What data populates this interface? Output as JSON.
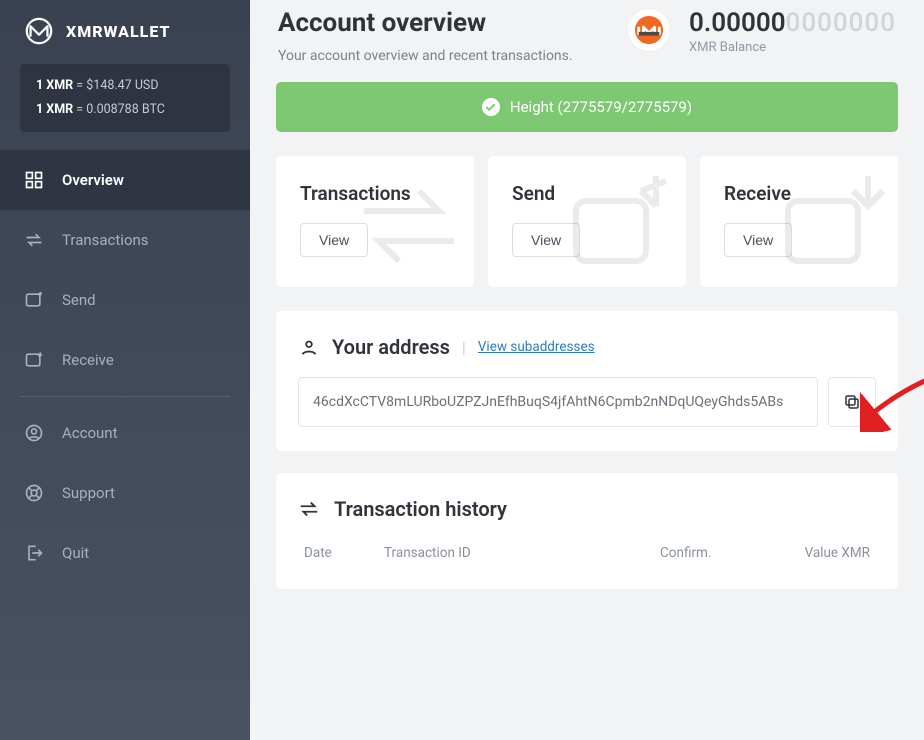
{
  "brand": "XMRWALLET",
  "rates": {
    "usd_label": "1 XMR",
    "usd_eq": "=",
    "usd_value": "$148.47",
    "usd_suffix": "USD",
    "btc_label": "1 XMR",
    "btc_eq": "=",
    "btc_value": "0.008788",
    "btc_suffix": "BTC"
  },
  "nav": {
    "overview": "Overview",
    "transactions": "Transactions",
    "send": "Send",
    "receive": "Receive",
    "account": "Account",
    "support": "Support",
    "quit": "Quit"
  },
  "header": {
    "title": "Account overview",
    "subtitle": "Your account overview and recent transactions.",
    "balance_main": "0.00000",
    "balance_faint": "0000000",
    "balance_label": "XMR Balance"
  },
  "height_banner": "Height (2775579/2775579)",
  "cards": {
    "transactions": {
      "title": "Transactions",
      "view": "View"
    },
    "send": {
      "title": "Send",
      "view": "View"
    },
    "receive": {
      "title": "Receive",
      "view": "View"
    }
  },
  "address_section": {
    "title": "Your address",
    "view_sub": "View subaddresses",
    "value": "46cdXcCTV8mLURboUZPZJnEfhBuqS4jfAhtN6Cpmb2nNDqUQeyGhds5ABs"
  },
  "history": {
    "title": "Transaction history",
    "cols": {
      "date": "Date",
      "txid": "Transaction ID",
      "confirm": "Confirm.",
      "value": "Value XMR"
    }
  }
}
